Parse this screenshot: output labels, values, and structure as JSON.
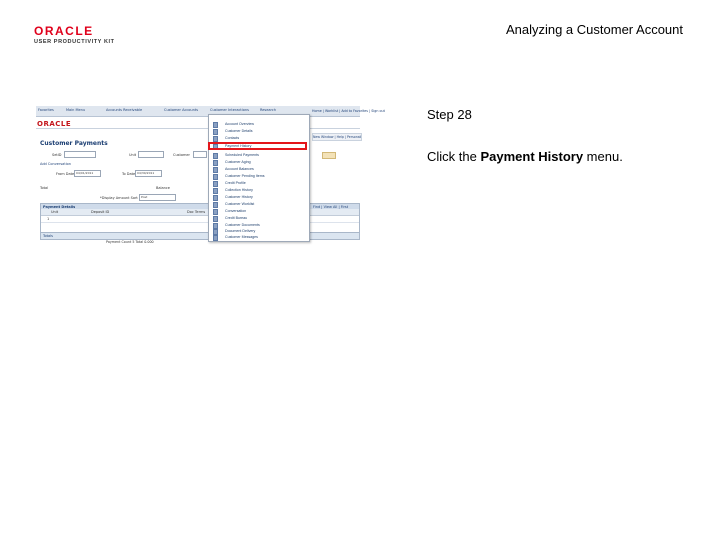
{
  "header": {
    "brand": "ORACLE",
    "brand_sub": "USER PRODUCTIVITY KIT",
    "title": "Analyzing a Customer Account"
  },
  "step": {
    "label": "Step 28",
    "instruction_prefix": "Click the ",
    "instruction_target": "Payment History",
    "instruction_suffix": " menu."
  },
  "screenshot": {
    "nav_items": [
      "Favorites",
      "Main Menu",
      "Accounts Receivable",
      "Customer Accounts",
      "Customer Interactions",
      "Research"
    ],
    "brand": "ORACLE",
    "right_nav": "Home | Worklist | Add to Favorites | Sign out",
    "toolbar": "New Window | Help | Personalize Page",
    "page_title": "Customer Payments",
    "fields": {
      "setid_label": "SetID",
      "unit_label": "Unit",
      "customer_label": "Customer",
      "add_conversation": "Add Conversation",
      "from_date_label": "From Date",
      "from_date_value": "04/01/2011",
      "to_date_label": "To Date",
      "to_date_value": "04/30/2011",
      "total_label": "Total",
      "balance_label": "Balance",
      "display_label": "*Display Amount Sort By",
      "display_value": "Post"
    },
    "grid": {
      "title": "Payment Details",
      "nav": "Find | View All | First",
      "columns": [
        "Unit",
        "Deposit ID",
        "Doc Terms"
      ],
      "first_row": "1",
      "totals_label": "Totals"
    },
    "footer": "Payment Count   5      Total        0.000"
  },
  "menu": {
    "items": [
      "Account Overview",
      "Customer Details",
      "Contacts",
      "Payment History",
      "Scheduled Payments",
      "Customer Aging",
      "Account Balances",
      "Customer Pending Items",
      "Credit Profile",
      "Collection History",
      "Customer History",
      "Customer Worklist",
      "Conversation",
      "Credit Bureau",
      "Customer Documents",
      "Document Delivery",
      "Customer Messages"
    ],
    "highlighted_index": 3
  },
  "colors": {
    "brand_red": "#e0001b",
    "highlight_red": "#e3161b",
    "link_blue": "#22426e"
  }
}
